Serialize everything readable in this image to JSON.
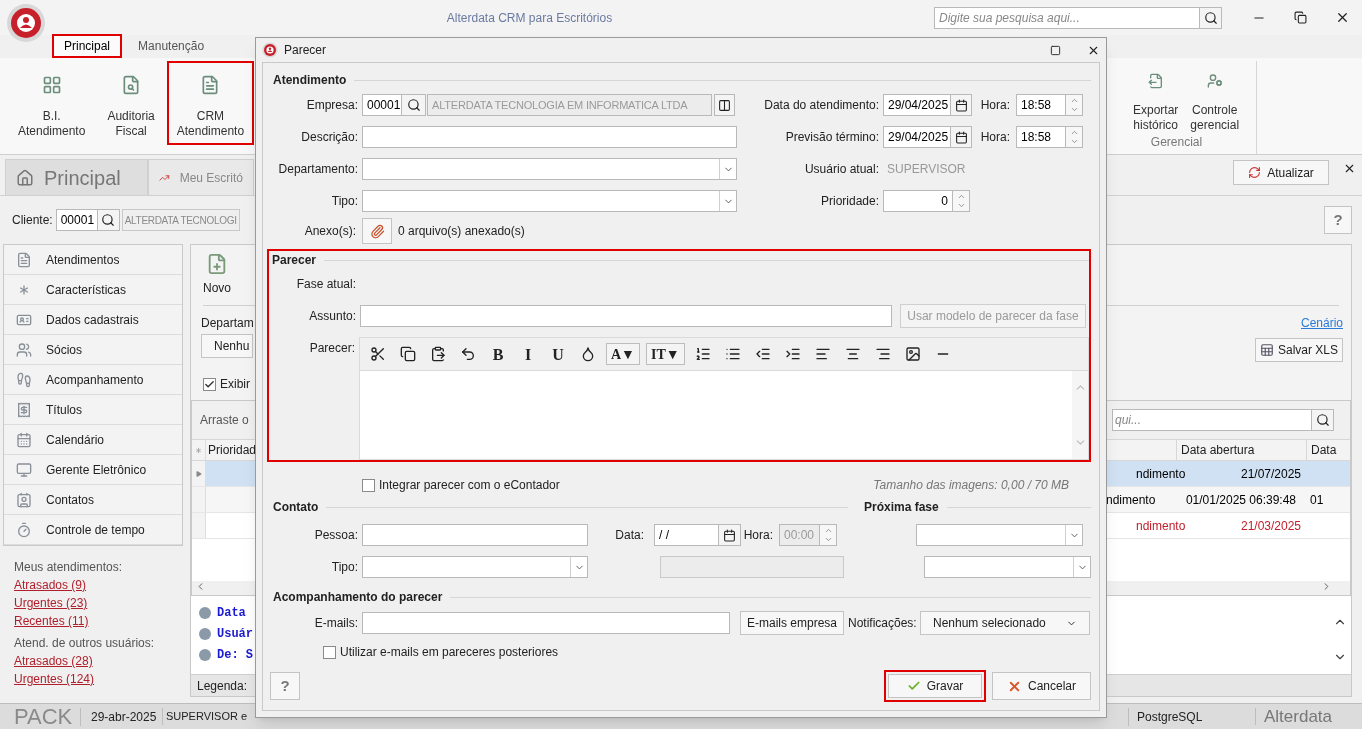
{
  "window": {
    "title": "Alterdata CRM para Escritórios",
    "search_placeholder": "Digite sua pesquisa aqui..."
  },
  "menu_tabs": [
    {
      "label": "Principal",
      "selected": true,
      "highlighted": true
    },
    {
      "label": "Manutenção",
      "selected": false,
      "highlighted": false
    }
  ],
  "ribbon": {
    "items": [
      {
        "label": "B.I. Atendimento",
        "highlighted": false
      },
      {
        "label": "Auditoria Fiscal",
        "highlighted": false
      },
      {
        "label": "CRM Atendimento",
        "highlighted": true
      }
    ],
    "group": {
      "label": "Gerencial",
      "items": [
        {
          "label": "Exportar histórico"
        },
        {
          "label": "Controle gerencial"
        }
      ]
    }
  },
  "doc_tabs": [
    {
      "label": "Principal",
      "selected": true
    },
    {
      "label": "Meu Escritó",
      "selected": false
    }
  ],
  "refresh_button": "Atualizar",
  "client": {
    "label": "Cliente:",
    "code": "00001",
    "name": "ALTERDATA TECNOLOGI"
  },
  "help_button": "?",
  "nav": [
    "Atendimentos",
    "Características",
    "Dados cadastrais",
    "Sócios",
    "Acompanhamento",
    "Títulos",
    "Calendário",
    "Gerente Eletrônico",
    "Contatos",
    "Controle de tempo"
  ],
  "my_cases": {
    "heading": "Meus atendimentos:",
    "links": [
      "Atrasados (9)",
      "Urgentes (23)",
      "Recentes (11)"
    ]
  },
  "other_cases": {
    "heading": "Atend. de outros usuários:",
    "links": [
      "Atrasados (28)",
      "Urgentes (124)"
    ]
  },
  "panel": {
    "new_button": "Novo",
    "department_label": "Departam",
    "department_value": "Nenhu",
    "show_all": {
      "label": "Exibir",
      "checked": true
    },
    "group_hint": "Arraste o",
    "scenario_link": "Cenário",
    "xls_button": "Salvar XLS",
    "search_placeholder": "qui...",
    "left_column": "Prioridad",
    "columns": [
      "",
      "Data abertura",
      "Data"
    ],
    "rows": [
      {
        "cells": [
          "ndimento",
          "21/07/2025"
        ],
        "selected": true,
        "overdue": false
      },
      {
        "cells": [
          "ndimento",
          "01/01/2025 06:39:48",
          "01"
        ],
        "selected": false,
        "overdue": false
      },
      {
        "cells": [
          "ndimento",
          "21/03/2025"
        ],
        "selected": false,
        "overdue": true
      }
    ],
    "legend": [
      "Data",
      "Usuár",
      "De: S"
    ],
    "legend_label": "Legenda:"
  },
  "status_bar": {
    "brand": "PACK",
    "date": "29-abr-2025",
    "user": "SUPERVISOR e",
    "database": "PostgreSQL",
    "vendor": "Alterdata"
  },
  "dialog": {
    "title": "Parecer",
    "atendimento": {
      "heading": "Atendimento",
      "empresa_label": "Empresa:",
      "empresa_code": "00001",
      "empresa_name": "ALTERDATA TECNOLOGIA EM INFORMATICA LTDA",
      "descricao_label": "Descrição:",
      "departamento_label": "Departamento:",
      "tipo_label": "Tipo:",
      "anexos_label": "Anexo(s):",
      "anexos_count": "0 arquivo(s) anexado(s)",
      "data_label": "Data do atendimento:",
      "data_value": "29/04/2025",
      "hora_label": "Hora:",
      "hora_value": "18:58",
      "previsao_label": "Previsão término:",
      "previsao_value": "29/04/2025",
      "hora2_label": "Hora:",
      "hora2_value": "18:58",
      "usuario_label": "Usuário atual:",
      "usuario_value": "SUPERVISOR",
      "prioridade_label": "Prioridade:",
      "prioridade_value": "0"
    },
    "parecer": {
      "heading": "Parecer",
      "highlighted": true,
      "fase_label": "Fase atual:",
      "assunto_label": "Assunto:",
      "template_button": "Usar modelo de parecer da fase",
      "template_disabled": true,
      "editor_label": "Parecer:",
      "toolbar": [
        {
          "kind": "cut"
        },
        {
          "kind": "copy"
        },
        {
          "kind": "paste"
        },
        {
          "kind": "undo"
        },
        {
          "kind": "text",
          "text": "B"
        },
        {
          "kind": "text",
          "text": "I"
        },
        {
          "kind": "text",
          "text": "U"
        },
        {
          "kind": "color"
        },
        {
          "kind": "dropdown",
          "text": "A▼"
        },
        {
          "kind": "dropdown",
          "text": "IT▼"
        },
        {
          "kind": "ordered-list"
        },
        {
          "kind": "bullet-list"
        },
        {
          "kind": "outdent"
        },
        {
          "kind": "indent"
        },
        {
          "kind": "align-left"
        },
        {
          "kind": "align-center"
        },
        {
          "kind": "align-right"
        },
        {
          "kind": "image"
        },
        {
          "kind": "rule"
        }
      ],
      "integrate": {
        "label": "Integrar parecer com o eContador",
        "checked": false
      },
      "image_size": "Tamanho das imagens: 0,00 / 70 MB"
    },
    "contato": {
      "heading": "Contato",
      "pessoa_label": "Pessoa:",
      "tipo_label": "Tipo:",
      "data_label": "Data:",
      "data_value": "/ /",
      "hora_label": "Hora:",
      "hora_value": "00:00"
    },
    "proxima_fase": {
      "heading": "Próxima fase"
    },
    "acompanhamento": {
      "heading": "Acompanhamento do parecer",
      "emails_label": "E-mails:",
      "emails_button": "E-mails empresa",
      "notif_label": "Notificações:",
      "notif_value": "Nenhum selecionado",
      "reuse": {
        "label": "Utilizar e-mails em pareceres posteriores",
        "checked": false
      }
    },
    "help_button": "?",
    "save_button": {
      "label": "Gravar",
      "highlighted": true
    },
    "cancel_button": "Cancelar"
  }
}
